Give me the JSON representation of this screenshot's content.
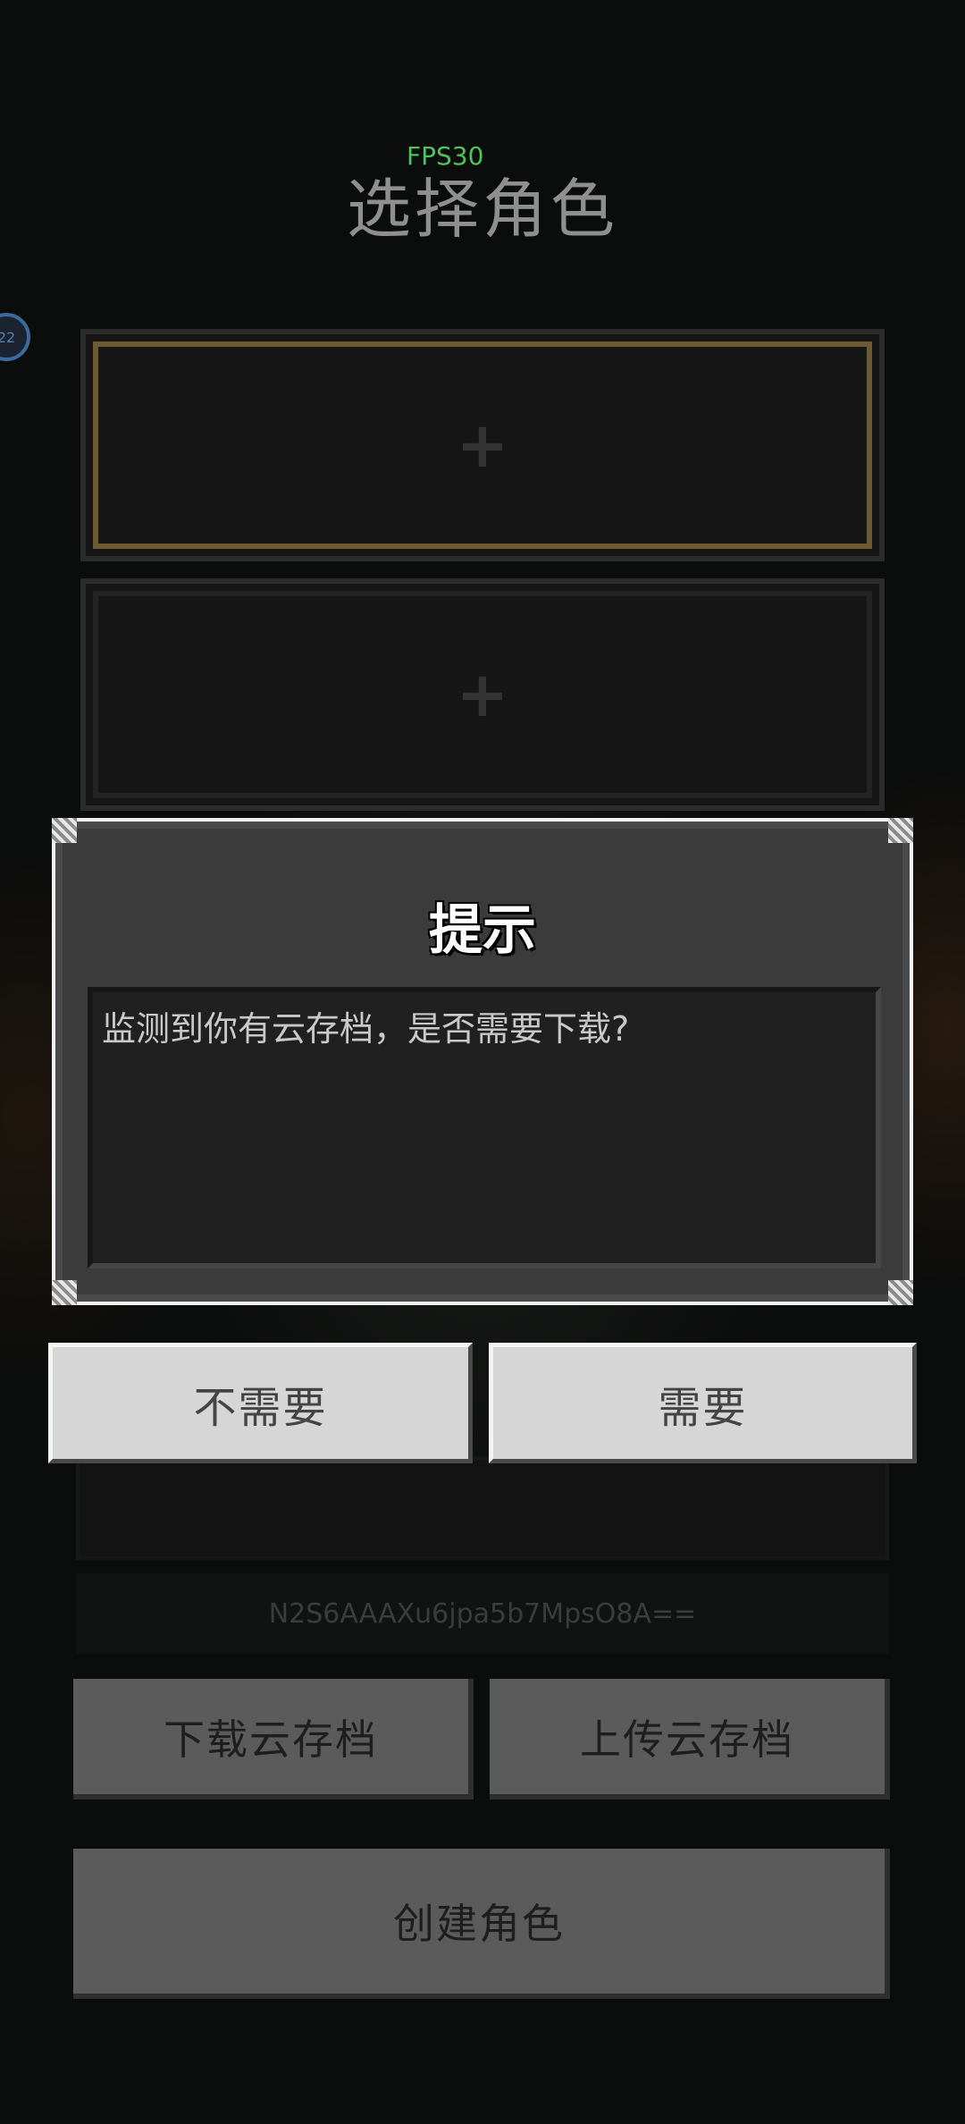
{
  "fps": "FPS30",
  "title": "选择角色",
  "badge": "22",
  "slots": [
    {
      "icon": "+",
      "selected": true
    },
    {
      "icon": "+",
      "selected": false
    }
  ],
  "device_id": "N2S6AAAXu6jpa5b7MpsO8A==",
  "buttons": {
    "download": "下载云存档",
    "upload": "上传云存档",
    "create": "创建角色"
  },
  "dialog": {
    "title": "提示",
    "message": "监测到你有云存档，是否需要下载?",
    "no_label": "不需要",
    "yes_label": "需要"
  },
  "colors": {
    "fps": "#4fc25a",
    "selected_border": "#6e5a32"
  }
}
